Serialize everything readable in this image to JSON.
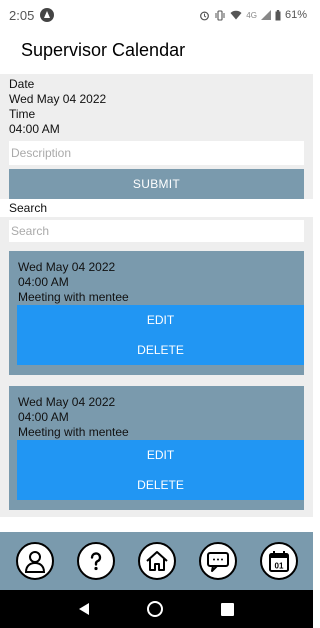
{
  "status_bar": {
    "time": "2:05",
    "network": "4G",
    "battery": "61%"
  },
  "app_title": "Supervisor Calendar",
  "form": {
    "date_label": "Date",
    "date_value": "Wed May 04 2022",
    "time_label": "Time",
    "time_value": "04:00 AM",
    "description_placeholder": "Description",
    "submit_label": "SUBMIT"
  },
  "search": {
    "label": "Search",
    "placeholder": "Search"
  },
  "events": [
    {
      "date": "Wed May 04 2022",
      "time": "04:00 AM",
      "title": "Meeting with mentee",
      "edit_label": "EDIT",
      "delete_label": "DELETE"
    },
    {
      "date": "Wed May 04 2022",
      "time": "04:00 AM",
      "title": "Meeting with mentee",
      "edit_label": "EDIT",
      "delete_label": "DELETE"
    }
  ],
  "bottom_tabs": [
    {
      "icon": "profile-icon"
    },
    {
      "icon": "help-icon"
    },
    {
      "icon": "home-icon"
    },
    {
      "icon": "chat-icon"
    },
    {
      "icon": "calendar-icon",
      "badge": "01"
    }
  ],
  "colors": {
    "card_bg": "#7a9aad",
    "button_blue": "#2196f3",
    "panel_bg": "#eeeeee"
  }
}
